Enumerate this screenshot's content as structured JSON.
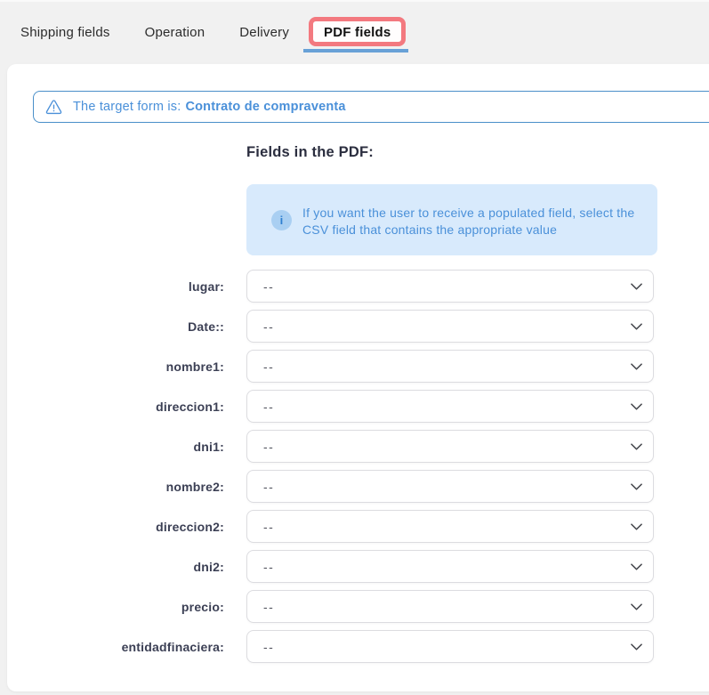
{
  "tabs": [
    {
      "id": "shipping-fields",
      "label": "Shipping fields",
      "active": false
    },
    {
      "id": "operation",
      "label": "Operation",
      "active": false
    },
    {
      "id": "delivery",
      "label": "Delivery",
      "active": false
    },
    {
      "id": "pdf-fields",
      "label": "PDF fields",
      "active": true,
      "highlighted": true
    }
  ],
  "alert": {
    "text": "The target form is:",
    "form_name": "Contrato de compraventa"
  },
  "section": {
    "heading": "Fields in the PDF:",
    "info_glyph": "i",
    "info_text": "If you want the user to receive a populated field, select the CSV field that contains the appropriate value"
  },
  "fields": [
    {
      "id": "lugar",
      "label": "lugar:",
      "value": "--"
    },
    {
      "id": "date",
      "label": "Date::",
      "value": "--"
    },
    {
      "id": "nombre1",
      "label": "nombre1:",
      "value": "--"
    },
    {
      "id": "direccion1",
      "label": "direccion1:",
      "value": "--"
    },
    {
      "id": "dni1",
      "label": "dni1:",
      "value": "--"
    },
    {
      "id": "nombre2",
      "label": "nombre2:",
      "value": "--"
    },
    {
      "id": "direccion2",
      "label": "direccion2:",
      "value": "--"
    },
    {
      "id": "dni2",
      "label": "dni2:",
      "value": "--"
    },
    {
      "id": "precio",
      "label": "precio:",
      "value": "--"
    },
    {
      "id": "entidadfinaciera",
      "label": "entidadfinaciera:",
      "value": "--"
    }
  ],
  "colors": {
    "page_bg": "#f1f1f1",
    "accent_blue": "#4a90d9",
    "alert_border": "#4a8fc9",
    "highlight_red": "#f3797f",
    "underline_blue": "#68a1d7",
    "info_bg": "#d8eafc",
    "info_icon_bg": "#a9cff2",
    "info_icon_fg": "#2e7fd1",
    "heading_color": "#2b2e3f",
    "label_color": "#3c4055",
    "tab_text": "#2c2c2c",
    "select_border": "#dcdce0",
    "select_text": "#53555f"
  }
}
